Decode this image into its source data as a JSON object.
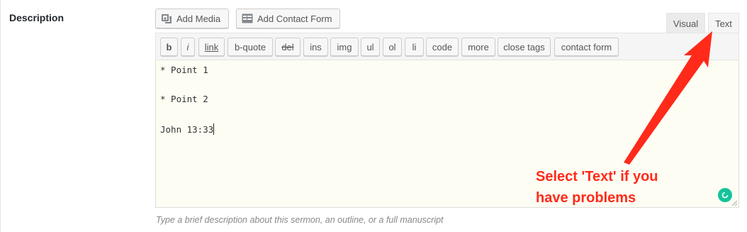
{
  "field": {
    "label": "Description"
  },
  "media_buttons": {
    "add_media": "Add Media",
    "add_contact_form": "Add Contact Form"
  },
  "tabs": {
    "visual": "Visual",
    "text": "Text"
  },
  "quicktags": [
    "b",
    "i",
    "link",
    "b-quote",
    "del",
    "ins",
    "img",
    "ul",
    "ol",
    "li",
    "code",
    "more",
    "close tags",
    "contact form"
  ],
  "editor": {
    "lines": [
      "* Point 1",
      "* Point 2",
      "John 13:33"
    ]
  },
  "hint": "Type a brief description about this sermon, an outline, or a full manuscript",
  "annotation": {
    "line1": "Select 'Text' if you",
    "line2": "have problems"
  },
  "colors": {
    "annotation": "#ff2a1a",
    "editor_bg": "#fdfdf3",
    "grammarly": "#15c39a"
  },
  "icons": {
    "add_media": "media-icon",
    "add_contact_form": "form-icon",
    "grammarly": "grammarly-icon"
  }
}
